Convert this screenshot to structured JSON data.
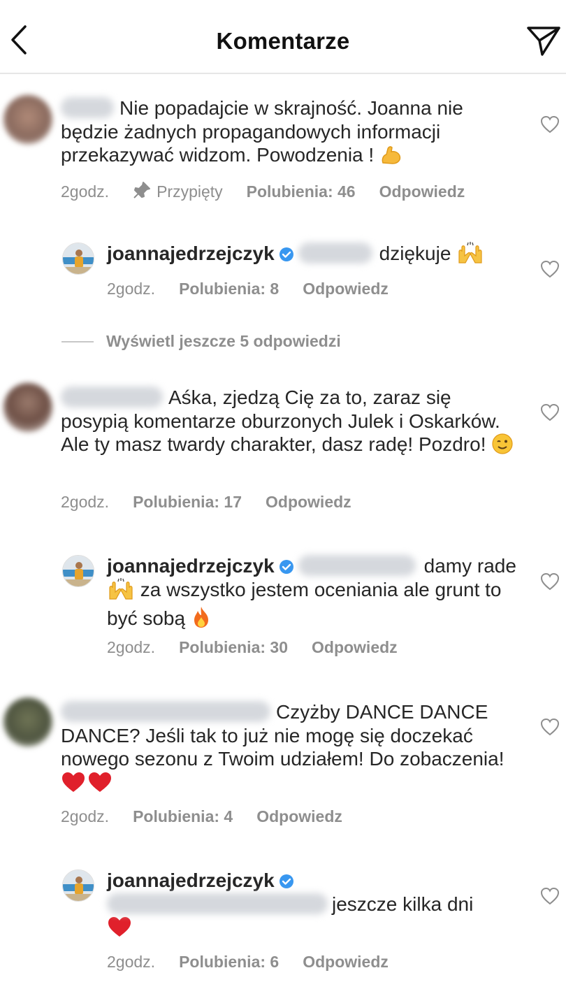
{
  "header": {
    "title": "Komentarze"
  },
  "labels": {
    "reply": "Odpowiedz",
    "pinned": "Przypięty"
  },
  "view_more": "Wyświetl jeszcze 5 odpowiedzi",
  "comments": [
    {
      "text": "Nie popadajcie w skrajność. Joanna nie będzie żadnych propagandowych informacji przekazywać widzom. Powodzenia !",
      "time": "2godz.",
      "likes": "Polubienia: 46"
    },
    {
      "username": "joannajedrzejczyk",
      "text": "dziękuje",
      "time": "2godz.",
      "likes": "Polubienia: 8"
    },
    {
      "text": "Aśka, zjedzą Cię za to, zaraz się posypią komentarze oburzonych Julek i Oskarków. Ale ty masz twardy charakter, dasz radę! Pozdro!",
      "time": "2godz.",
      "likes": "Polubienia: 17"
    },
    {
      "username": "joannajedrzejczyk",
      "text_a": "damy rade",
      "text_b": "za wszystko jestem oceniania ale grunt to być sobą",
      "time": "2godz.",
      "likes": "Polubienia: 30"
    },
    {
      "text": "Czyżby DANCE DANCE DANCE? Jeśli tak to już nie mogę się doczekać nowego sezonu z Twoim udziałem! Do zobaczenia!",
      "time": "2godz.",
      "likes": "Polubienia: 4"
    },
    {
      "username": "joannajedrzejczyk",
      "text": "jeszcze kilka dni",
      "time": "2godz.",
      "likes": "Polubienia: 6"
    }
  ],
  "icons": {
    "back": "chevron-left-icon",
    "send": "paper-plane-icon",
    "like": "heart-outline-icon",
    "pin": "pin-icon",
    "verified": "verified-badge-icon"
  },
  "colors": {
    "verified": "#3897f0",
    "muted": "#8e8e8e",
    "text": "#262626"
  }
}
